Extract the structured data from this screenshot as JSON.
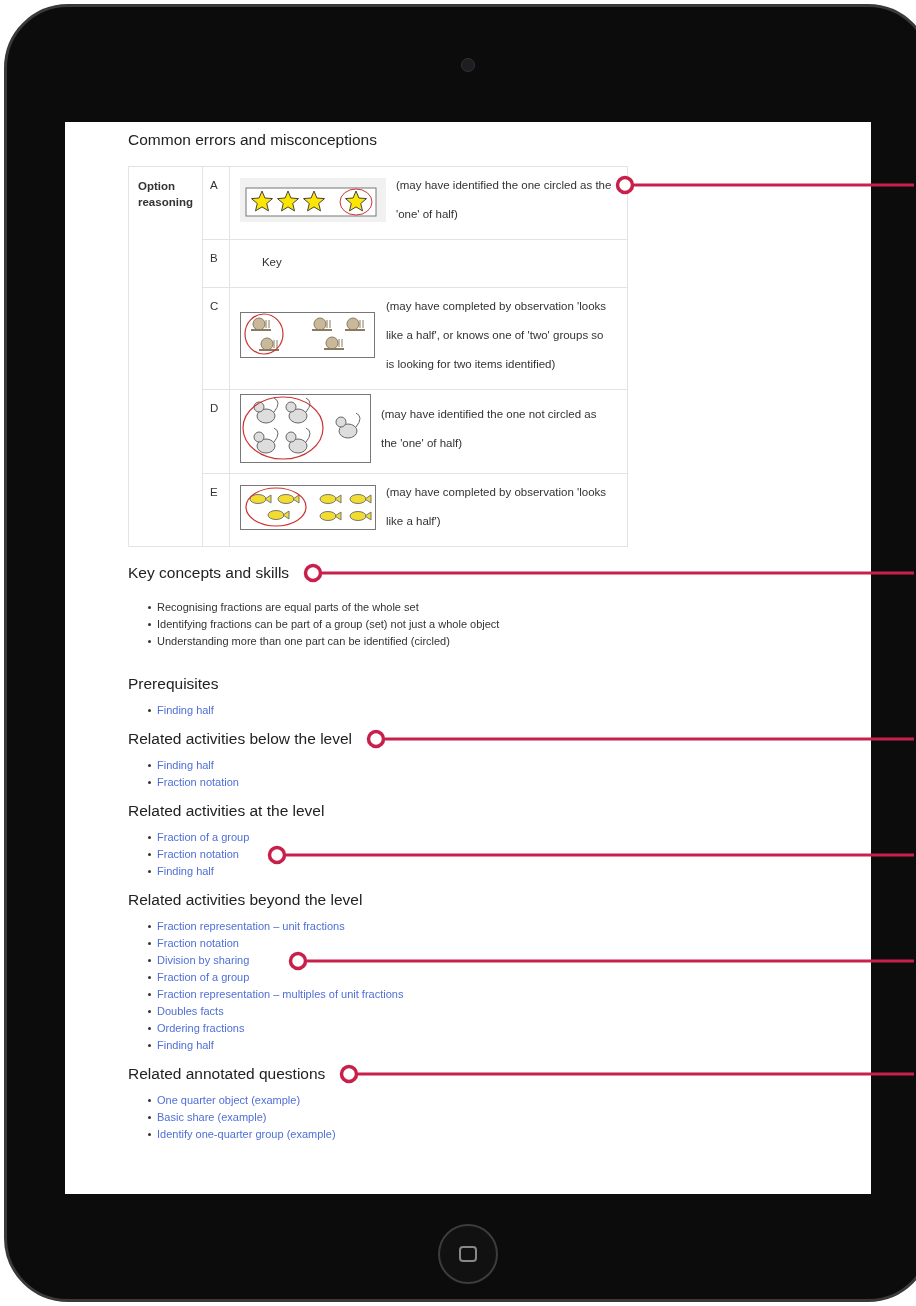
{
  "errors": {
    "title": "Common errors and misconceptions",
    "row_heading": "Option reasoning",
    "options": [
      {
        "option": "A",
        "kind": "stars",
        "text": "(may have identified the one circled as the 'one' of half)"
      },
      {
        "option": "B",
        "kind": "text",
        "text": "Key"
      },
      {
        "option": "C",
        "kind": "snails",
        "text": "(may have completed by observation 'looks like a half', or knows one of 'two' groups so is looking for two items identified)"
      },
      {
        "option": "D",
        "kind": "cats",
        "text": "(may have identified the one not circled as the 'one' of half)"
      },
      {
        "option": "E",
        "kind": "fish",
        "text": "(may have completed by observation 'looks like a half')"
      }
    ]
  },
  "sections": [
    {
      "title": "Key concepts and skills",
      "kind": "text",
      "items": [
        "Recognising fractions are equal parts of the whole set",
        "Identifying fractions can be part of a group (set) not just a whole object",
        "Understanding more than one part can be identified (circled)"
      ]
    },
    {
      "title": "Prerequisites",
      "kind": "links",
      "items": [
        "Finding half"
      ]
    },
    {
      "title": "Related activities below the level",
      "kind": "links",
      "items": [
        "Finding half",
        "Fraction notation"
      ]
    },
    {
      "title": "Related activities at the level",
      "kind": "links",
      "items": [
        "Fraction of a group",
        "Fraction notation",
        "Finding half"
      ]
    },
    {
      "title": "Related activities beyond the level",
      "kind": "links",
      "items": [
        "Fraction representation – unit fractions",
        "Fraction notation",
        "Division by sharing",
        "Fraction of a group",
        "Fraction representation – multiples of unit fractions",
        "Doubles facts",
        "Ordering fractions",
        "Finding half"
      ]
    },
    {
      "title": "Related annotated questions",
      "kind": "links",
      "items": [
        "One quarter object (example)",
        "Basic share (example)",
        "Identify one-quarter group (example)"
      ]
    }
  ]
}
